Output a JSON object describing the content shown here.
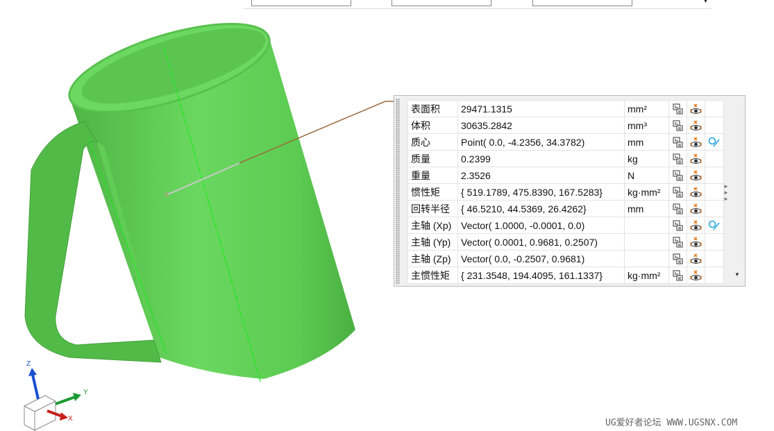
{
  "properties": [
    {
      "label": "表面积",
      "value": "29471.1315",
      "unit": "mm²",
      "point": false
    },
    {
      "label": "体积",
      "value": "30635.2842",
      "unit": "mm³",
      "point": false
    },
    {
      "label": "质心",
      "value": "Point( 0.0, -4.2356, 34.3782)",
      "unit": "mm",
      "point": true
    },
    {
      "label": "质量",
      "value": "0.2399",
      "unit": "kg",
      "point": false
    },
    {
      "label": "重量",
      "value": "2.3526",
      "unit": "N",
      "point": false
    },
    {
      "label": "惯性矩",
      "value": "{ 519.1789, 475.8390, 167.5283}",
      "unit": "kg·mm²",
      "point": false
    },
    {
      "label": "回转半径",
      "value": "{ 46.5210, 44.5369, 26.4262}",
      "unit": "mm",
      "point": false
    },
    {
      "label": "主轴 (Xp)",
      "value": "Vector( 1.0000, -0.0001, 0.0)",
      "unit": "",
      "point": true
    },
    {
      "label": "主轴 (Yp)",
      "value": "Vector( 0.0001, 0.9681, 0.2507)",
      "unit": "",
      "point": false
    },
    {
      "label": "主轴 (Zp)",
      "value": "Vector( 0.0, -0.2507, 0.9681)",
      "unit": "",
      "point": false
    },
    {
      "label": "主惯性矩",
      "value": "{ 231.3548, 194.4095, 161.1337}",
      "unit": "kg·mm²",
      "point": false
    }
  ],
  "triad": {
    "x": "X",
    "y": "Y",
    "z": "Z"
  },
  "watermark": "UG爱好者论坛 WWW.UGSNX.COM",
  "colors": {
    "model": "#5fcf55",
    "leader": "#9a6a3a",
    "icon_orange": "#e8720c",
    "icon_blue": "#1aa0e0"
  }
}
